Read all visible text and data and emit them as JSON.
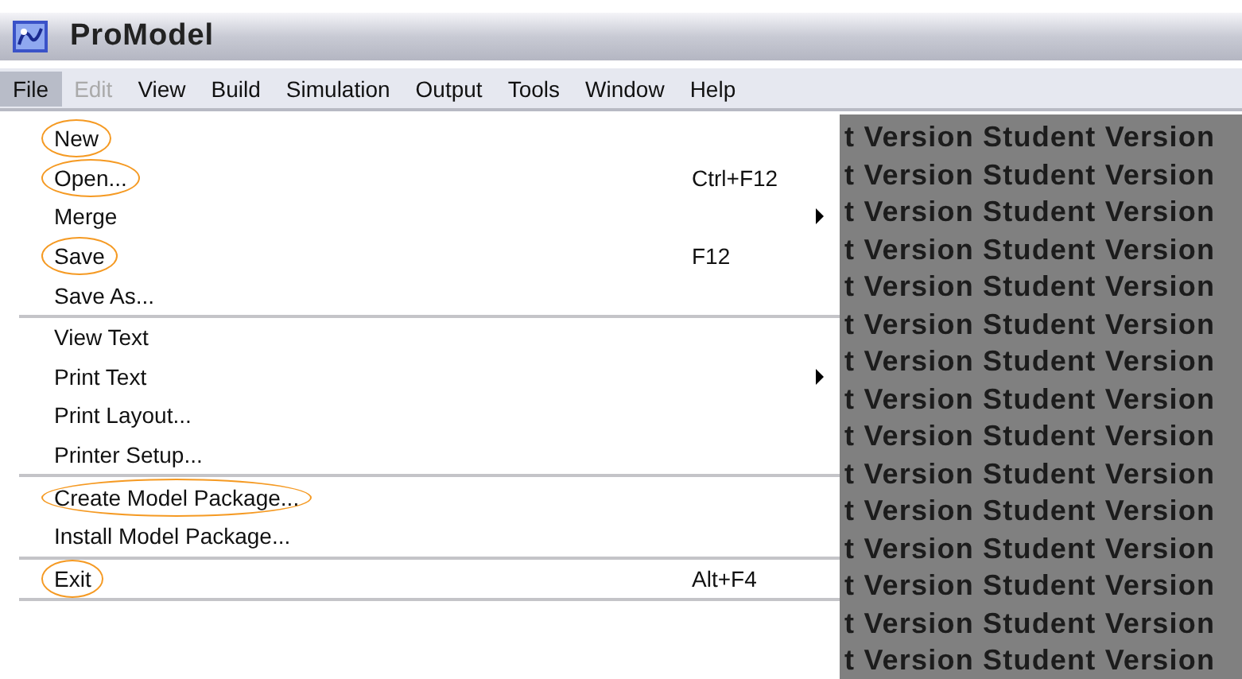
{
  "window": {
    "title": "ProModel"
  },
  "menu_bar": [
    {
      "label": "File",
      "selected": true,
      "disabled": false
    },
    {
      "label": "Edit",
      "selected": false,
      "disabled": true
    },
    {
      "label": "View",
      "selected": false,
      "disabled": false
    },
    {
      "label": "Build",
      "selected": false,
      "disabled": false
    },
    {
      "label": "Simulation",
      "selected": false,
      "disabled": false
    },
    {
      "label": "Output",
      "selected": false,
      "disabled": false
    },
    {
      "label": "Tools",
      "selected": false,
      "disabled": false
    },
    {
      "label": "Window",
      "selected": false,
      "disabled": false
    },
    {
      "label": "Help",
      "selected": false,
      "disabled": false
    }
  ],
  "file_menu": {
    "groups": [
      [
        {
          "label": "New",
          "submenu": false,
          "highlighted": true
        },
        {
          "label": "Open...",
          "shortcut": "Ctrl+F12",
          "submenu": false,
          "highlighted": true
        },
        {
          "label": "Merge",
          "submenu": true,
          "highlighted": false
        },
        {
          "label": "Save",
          "shortcut": "F12",
          "submenu": false,
          "highlighted": true
        },
        {
          "label": "Save As...",
          "submenu": false,
          "highlighted": false
        }
      ],
      [
        {
          "label": "View Text",
          "submenu": false,
          "highlighted": false
        },
        {
          "label": "Print Text",
          "submenu": true,
          "highlighted": false
        },
        {
          "label": "Print Layout...",
          "submenu": false,
          "highlighted": false
        },
        {
          "label": "Printer Setup...",
          "submenu": false,
          "highlighted": false
        }
      ],
      [
        {
          "label": "Create Model Package...",
          "submenu": false,
          "highlighted": true
        },
        {
          "label": "Install Model Package...",
          "submenu": false,
          "highlighted": false
        }
      ],
      [
        {
          "label": "Exit",
          "shortcut": "Alt+F4",
          "submenu": false,
          "highlighted": true
        }
      ]
    ]
  },
  "workspace": {
    "background_lines": [
      "t Version Student Version",
      "t Version Student Version",
      "t Version Student Version",
      "t Version Student Version",
      "t Version Student Version",
      "t Version Student Version",
      "t Version Student Version",
      "t Version Student Version",
      "t Version Student Version",
      "t Version Student Version",
      "t Version Student Version",
      "t Version Student Version",
      "t Version Student Version",
      "t Version Student Version",
      "t Version Student Version"
    ]
  }
}
